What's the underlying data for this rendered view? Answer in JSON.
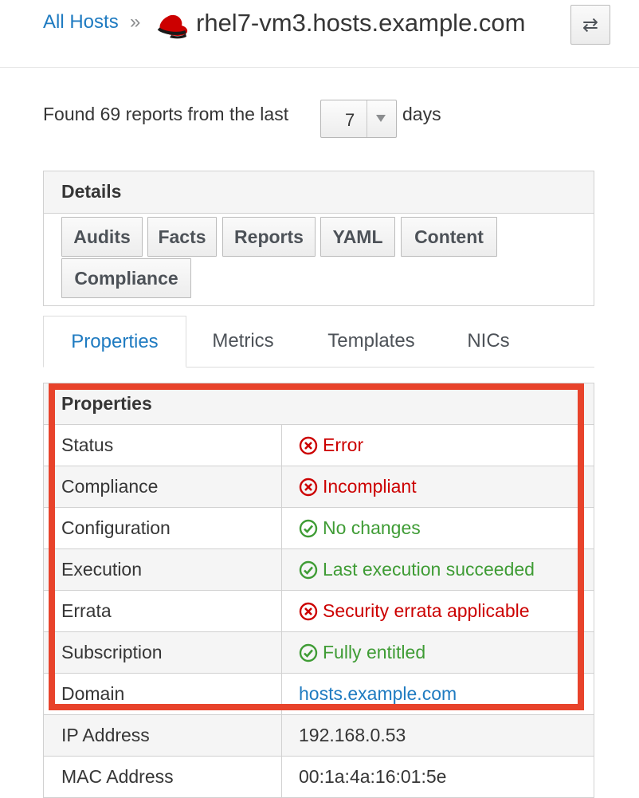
{
  "breadcrumb": {
    "parent_label": "All Hosts",
    "separator": "»",
    "current": "rhel7-vm3.hosts.example.com"
  },
  "header": {
    "os_icon": "redhat-icon",
    "switch_icon": "switch-arrows-icon",
    "switch_glyph": "⇄"
  },
  "reports": {
    "prefix": "Found 69 reports from the last",
    "days_value": "7",
    "suffix": "days"
  },
  "details": {
    "title": "Details",
    "buttons": [
      "Audits",
      "Facts",
      "Reports",
      "YAML",
      "Content",
      "Compliance"
    ]
  },
  "tabs": [
    "Properties",
    "Metrics",
    "Templates",
    "NICs"
  ],
  "properties": {
    "title": "Properties",
    "rows": [
      {
        "label": "Status",
        "value": "Error",
        "state": "error"
      },
      {
        "label": "Compliance",
        "value": "Incompliant",
        "state": "error"
      },
      {
        "label": "Configuration",
        "value": "No changes",
        "state": "ok"
      },
      {
        "label": "Execution",
        "value": "Last execution succeeded",
        "state": "ok"
      },
      {
        "label": "Errata",
        "value": "Security errata applicable",
        "state": "error"
      },
      {
        "label": "Subscription",
        "value": "Fully entitled",
        "state": "ok"
      },
      {
        "label": "Domain",
        "value": "hosts.example.com",
        "state": "link"
      },
      {
        "label": "IP Address",
        "value": "192.168.0.53",
        "state": "plain"
      },
      {
        "label": "MAC Address",
        "value": "00:1a:4a:16:01:5e",
        "state": "plain"
      }
    ]
  },
  "colors": {
    "link": "#1f7bc1",
    "error": "#cc0000",
    "ok": "#3f9c35",
    "highlight": "#e8432b"
  }
}
